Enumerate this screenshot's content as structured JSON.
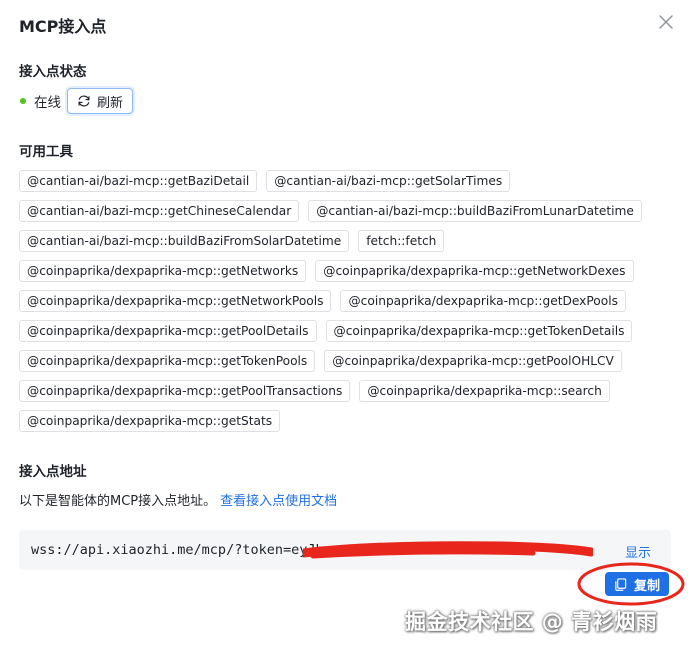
{
  "dialog": {
    "title": "MCP接入点"
  },
  "status": {
    "section_title": "接入点状态",
    "state_text": "在线",
    "refresh_label": "刷新",
    "state_color": "#52c41a"
  },
  "tools": {
    "section_title": "可用工具",
    "items": [
      "@cantian-ai/bazi-mcp::getBaziDetail",
      "@cantian-ai/bazi-mcp::getSolarTimes",
      "@cantian-ai/bazi-mcp::getChineseCalendar",
      "@cantian-ai/bazi-mcp::buildBaziFromLunarDatetime",
      "@cantian-ai/bazi-mcp::buildBaziFromSolarDatetime",
      "fetch::fetch",
      "@coinpaprika/dexpaprika-mcp::getNetworks",
      "@coinpaprika/dexpaprika-mcp::getNetworkDexes",
      "@coinpaprika/dexpaprika-mcp::getNetworkPools",
      "@coinpaprika/dexpaprika-mcp::getDexPools",
      "@coinpaprika/dexpaprika-mcp::getPoolDetails",
      "@coinpaprika/dexpaprika-mcp::getTokenDetails",
      "@coinpaprika/dexpaprika-mcp::getTokenPools",
      "@coinpaprika/dexpaprika-mcp::getPoolOHLCV",
      "@coinpaprika/dexpaprika-mcp::getPoolTransactions",
      "@coinpaprika/dexpaprika-mcp::search",
      "@coinpaprika/dexpaprika-mcp::getStats"
    ]
  },
  "endpoint": {
    "section_title": "接入点地址",
    "description": "以下是智能体的MCP接入点地址。",
    "doc_link": "查看接入点使用文档",
    "url": "wss://api.xiaozhi.me/mcp/?token=eyJh",
    "show_label": "显示",
    "copy_label": "复制",
    "accent_color": "#1f6fe5",
    "annotation_color": "#e8261c"
  },
  "watermark": {
    "text": "掘金技术社区 @ 青衫烟雨"
  },
  "icons": {
    "close": "close-icon",
    "refresh": "refresh-icon",
    "copy": "copy-icon"
  }
}
